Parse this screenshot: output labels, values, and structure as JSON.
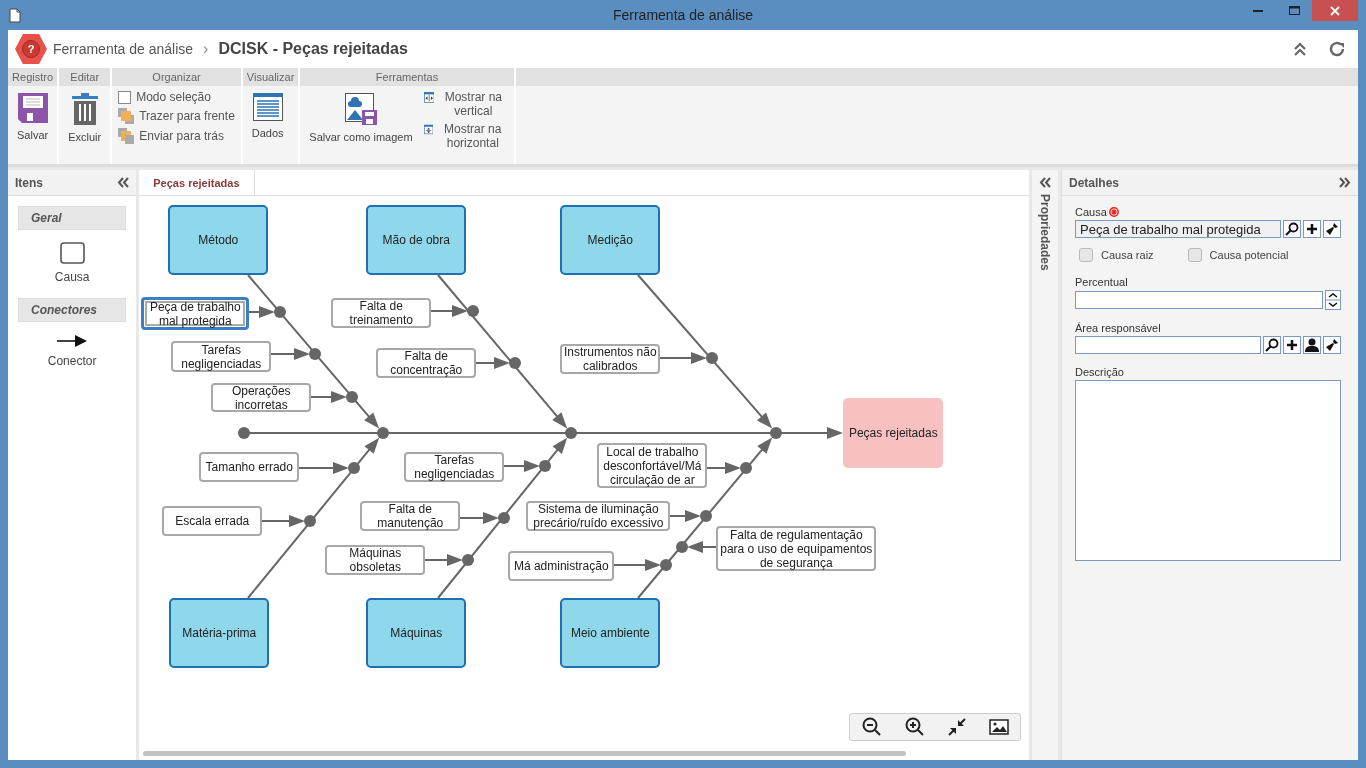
{
  "window": {
    "title": "Ferramenta de análise"
  },
  "header": {
    "logo_mark": "?",
    "breadcrumb": "Ferramenta de análise",
    "separator": "›",
    "title": "DCISK - Peças rejeitadas"
  },
  "ribbon": {
    "groups": [
      {
        "label": "Registro",
        "items": [
          {
            "kind": "large",
            "label": "Salvar"
          }
        ]
      },
      {
        "label": "Editar",
        "items": [
          {
            "kind": "large",
            "label": "Excluir"
          }
        ]
      },
      {
        "label": "Organizar",
        "items": [
          {
            "kind": "checkbox",
            "label": "Modo seleção",
            "checked": false
          },
          {
            "kind": "small",
            "label": "Trazer para frente"
          },
          {
            "kind": "small",
            "label": "Enviar para trás"
          }
        ]
      },
      {
        "label": "Visualizar",
        "items": [
          {
            "kind": "large",
            "label": "Dados"
          }
        ]
      },
      {
        "label": "Ferramentas",
        "items": [
          {
            "kind": "large",
            "label": "Salvar como imagem"
          },
          {
            "kind": "small",
            "label": "Mostrar na vertical"
          },
          {
            "kind": "small",
            "label": "Mostrar na horizontal"
          }
        ]
      }
    ]
  },
  "items_panel": {
    "title": "Itens",
    "sections": [
      {
        "title": "Geral",
        "items": [
          {
            "label": "Causa"
          }
        ]
      },
      {
        "title": "Conectores",
        "items": [
          {
            "label": "Conector"
          }
        ]
      }
    ]
  },
  "tabs": [
    {
      "label": "Peças rejeitadas",
      "selected": true
    }
  ],
  "diagram": {
    "effect": "Peças rejeitadas",
    "categories": [
      {
        "label": "Método",
        "causes": [
          {
            "label": "Peça de trabalho mal protegida",
            "selected": true
          },
          {
            "label": "Tarefas negligenciadas",
            "selected": false
          },
          {
            "label": "Operações incorretas",
            "selected": false
          }
        ]
      },
      {
        "label": "Mão de obra",
        "causes": [
          {
            "label": "Falta de treinamento",
            "selected": false
          },
          {
            "label": "Falta de concentração",
            "selected": false
          }
        ]
      },
      {
        "label": "Medição",
        "causes": [
          {
            "label": "Instrumentos não calibrados",
            "selected": false
          }
        ]
      },
      {
        "label": "Matéria-prima",
        "causes": [
          {
            "label": "Tamanho errado",
            "selected": false
          },
          {
            "label": "Escala errada",
            "selected": false
          }
        ]
      },
      {
        "label": "Máquinas",
        "causes": [
          {
            "label": "Tarefas negligenciadas",
            "selected": false
          },
          {
            "label": "Falta de manutenção",
            "selected": false
          },
          {
            "label": "Máquinas obsoletas",
            "selected": false
          }
        ]
      },
      {
        "label": "Meio ambiente",
        "causes": [
          {
            "label": "Local de trabalho desconfortável/Má circulação de ar",
            "selected": false
          },
          {
            "label": "Sistema de iluminação precário/ruído excessivo",
            "selected": false
          },
          {
            "label": "Má administração",
            "selected": false
          },
          {
            "label": "Falta de regulamentação para o uso de equipamentos de segurança",
            "selected": false
          }
        ]
      }
    ]
  },
  "properties_strip": {
    "label": "Propriedades"
  },
  "details": {
    "title": "Detalhes",
    "fields": [
      {
        "kind": "lookup",
        "label": "Causa",
        "required": true,
        "value": "Peça de trabalho mal protegida"
      },
      {
        "kind": "checkboxes",
        "options": [
          {
            "label": "Causa raiz",
            "checked": false
          },
          {
            "label": "Causa potencial",
            "checked": false
          }
        ]
      },
      {
        "kind": "spinner",
        "label": "Percentual"
      },
      {
        "kind": "userlookup",
        "label": "Área responsável"
      },
      {
        "kind": "textarea",
        "label": "Descrição"
      }
    ]
  }
}
